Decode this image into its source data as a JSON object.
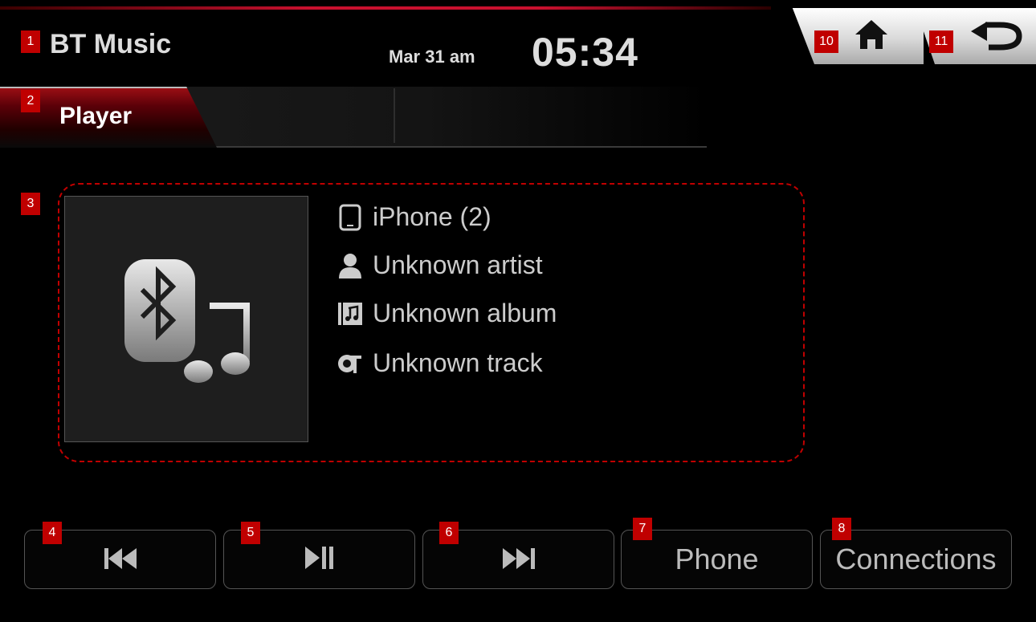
{
  "header": {
    "app_title": "BT Music",
    "date": "Mar 31 am",
    "time": "05:34"
  },
  "nav": {
    "home_icon": "home-icon",
    "back_icon": "back-arrow-icon"
  },
  "tabs": [
    {
      "label": "Player",
      "active": true
    }
  ],
  "track_info": {
    "device": "iPhone (2)",
    "artist": "Unknown artist",
    "album": "Unknown album",
    "track": "Unknown track",
    "art_icon": "bluetooth-music-icon"
  },
  "controls": {
    "prev_icon": "skip-previous-icon",
    "play_pause_icon": "play-pause-icon",
    "next_icon": "skip-next-icon",
    "phone_label": "Phone",
    "connections_label": "Connections"
  },
  "annotations": [
    "1",
    "2",
    "3",
    "4",
    "5",
    "6",
    "7",
    "8",
    "10",
    "11"
  ],
  "colors": {
    "accent": "#c8102e",
    "annotation_badge": "#c00000",
    "text": "#dddddd",
    "background": "#000000"
  }
}
